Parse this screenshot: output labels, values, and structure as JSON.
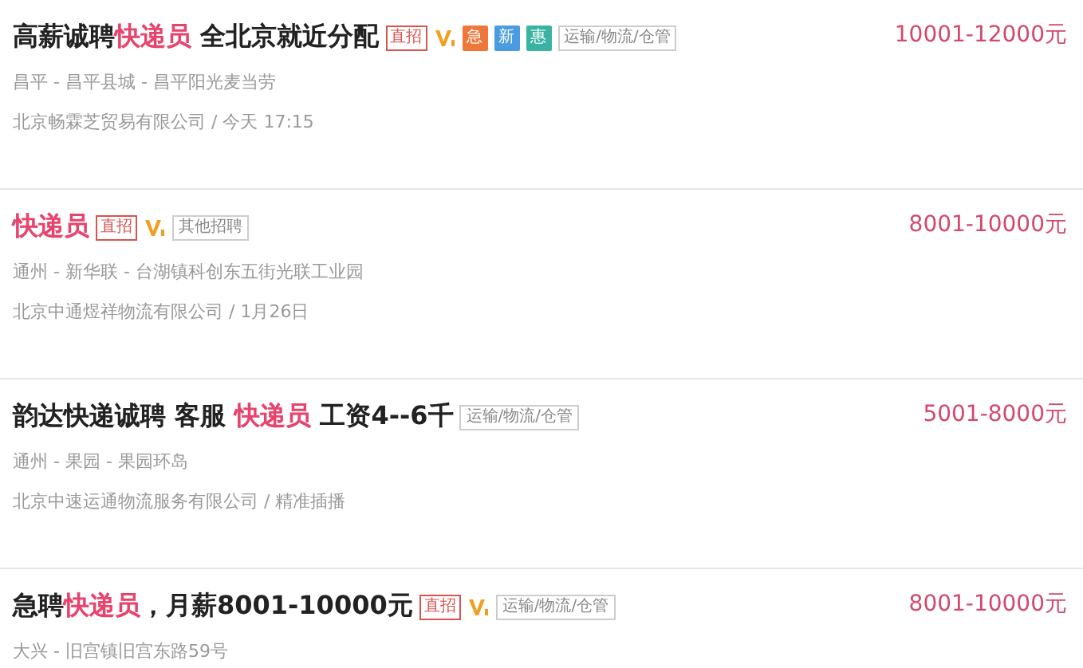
{
  "jobs": [
    {
      "title": [
        {
          "text": "高薪诚聘",
          "highlight": false
        },
        {
          "text": "快递员",
          "highlight": true
        },
        {
          "text": " 全北京就近分配",
          "highlight": false
        }
      ],
      "badges": [
        {
          "kind": "direct",
          "text": "直招"
        },
        {
          "kind": "vip"
        },
        {
          "kind": "urgent",
          "text": "急"
        },
        {
          "kind": "new",
          "text": "新"
        },
        {
          "kind": "benefit",
          "text": "惠"
        },
        {
          "kind": "category",
          "text": "运输/物流/仓管"
        }
      ],
      "location": "昌平 - 昌平县城 - 昌平阳光麦当劳",
      "company": "北京畅霖芝贸易有限公司 / 今天 17:15",
      "salary": "10001-12000元"
    },
    {
      "title": [
        {
          "text": "快递员",
          "highlight": true
        }
      ],
      "badges": [
        {
          "kind": "direct",
          "text": "直招"
        },
        {
          "kind": "vip"
        },
        {
          "kind": "category",
          "text": "其他招聘"
        }
      ],
      "location": "通州 - 新华联 - 台湖镇科创东五街光联工业园",
      "company": "北京中通煜祥物流有限公司 / 1月26日",
      "salary": "8001-10000元"
    },
    {
      "title": [
        {
          "text": "韵达快递诚聘 客服 ",
          "highlight": false
        },
        {
          "text": "快递员",
          "highlight": true
        },
        {
          "text": " 工资4--6千",
          "highlight": false
        }
      ],
      "badges": [
        {
          "kind": "category",
          "text": "运输/物流/仓管"
        }
      ],
      "location": "通州 - 果园 - 果园环岛",
      "company": "北京中速运通物流服务有限公司 / 精准插播",
      "salary": "5001-8000元"
    },
    {
      "title": [
        {
          "text": "急聘",
          "highlight": false
        },
        {
          "text": "快递员",
          "highlight": true
        },
        {
          "text": "，月薪8001-10000元",
          "highlight": false
        }
      ],
      "badges": [
        {
          "kind": "direct",
          "text": "直招"
        },
        {
          "kind": "vip"
        },
        {
          "kind": "category",
          "text": "运输/物流/仓管"
        }
      ],
      "location": "大兴 - 旧宫镇旧宫东路59号",
      "salary": "8001-10000元"
    }
  ]
}
